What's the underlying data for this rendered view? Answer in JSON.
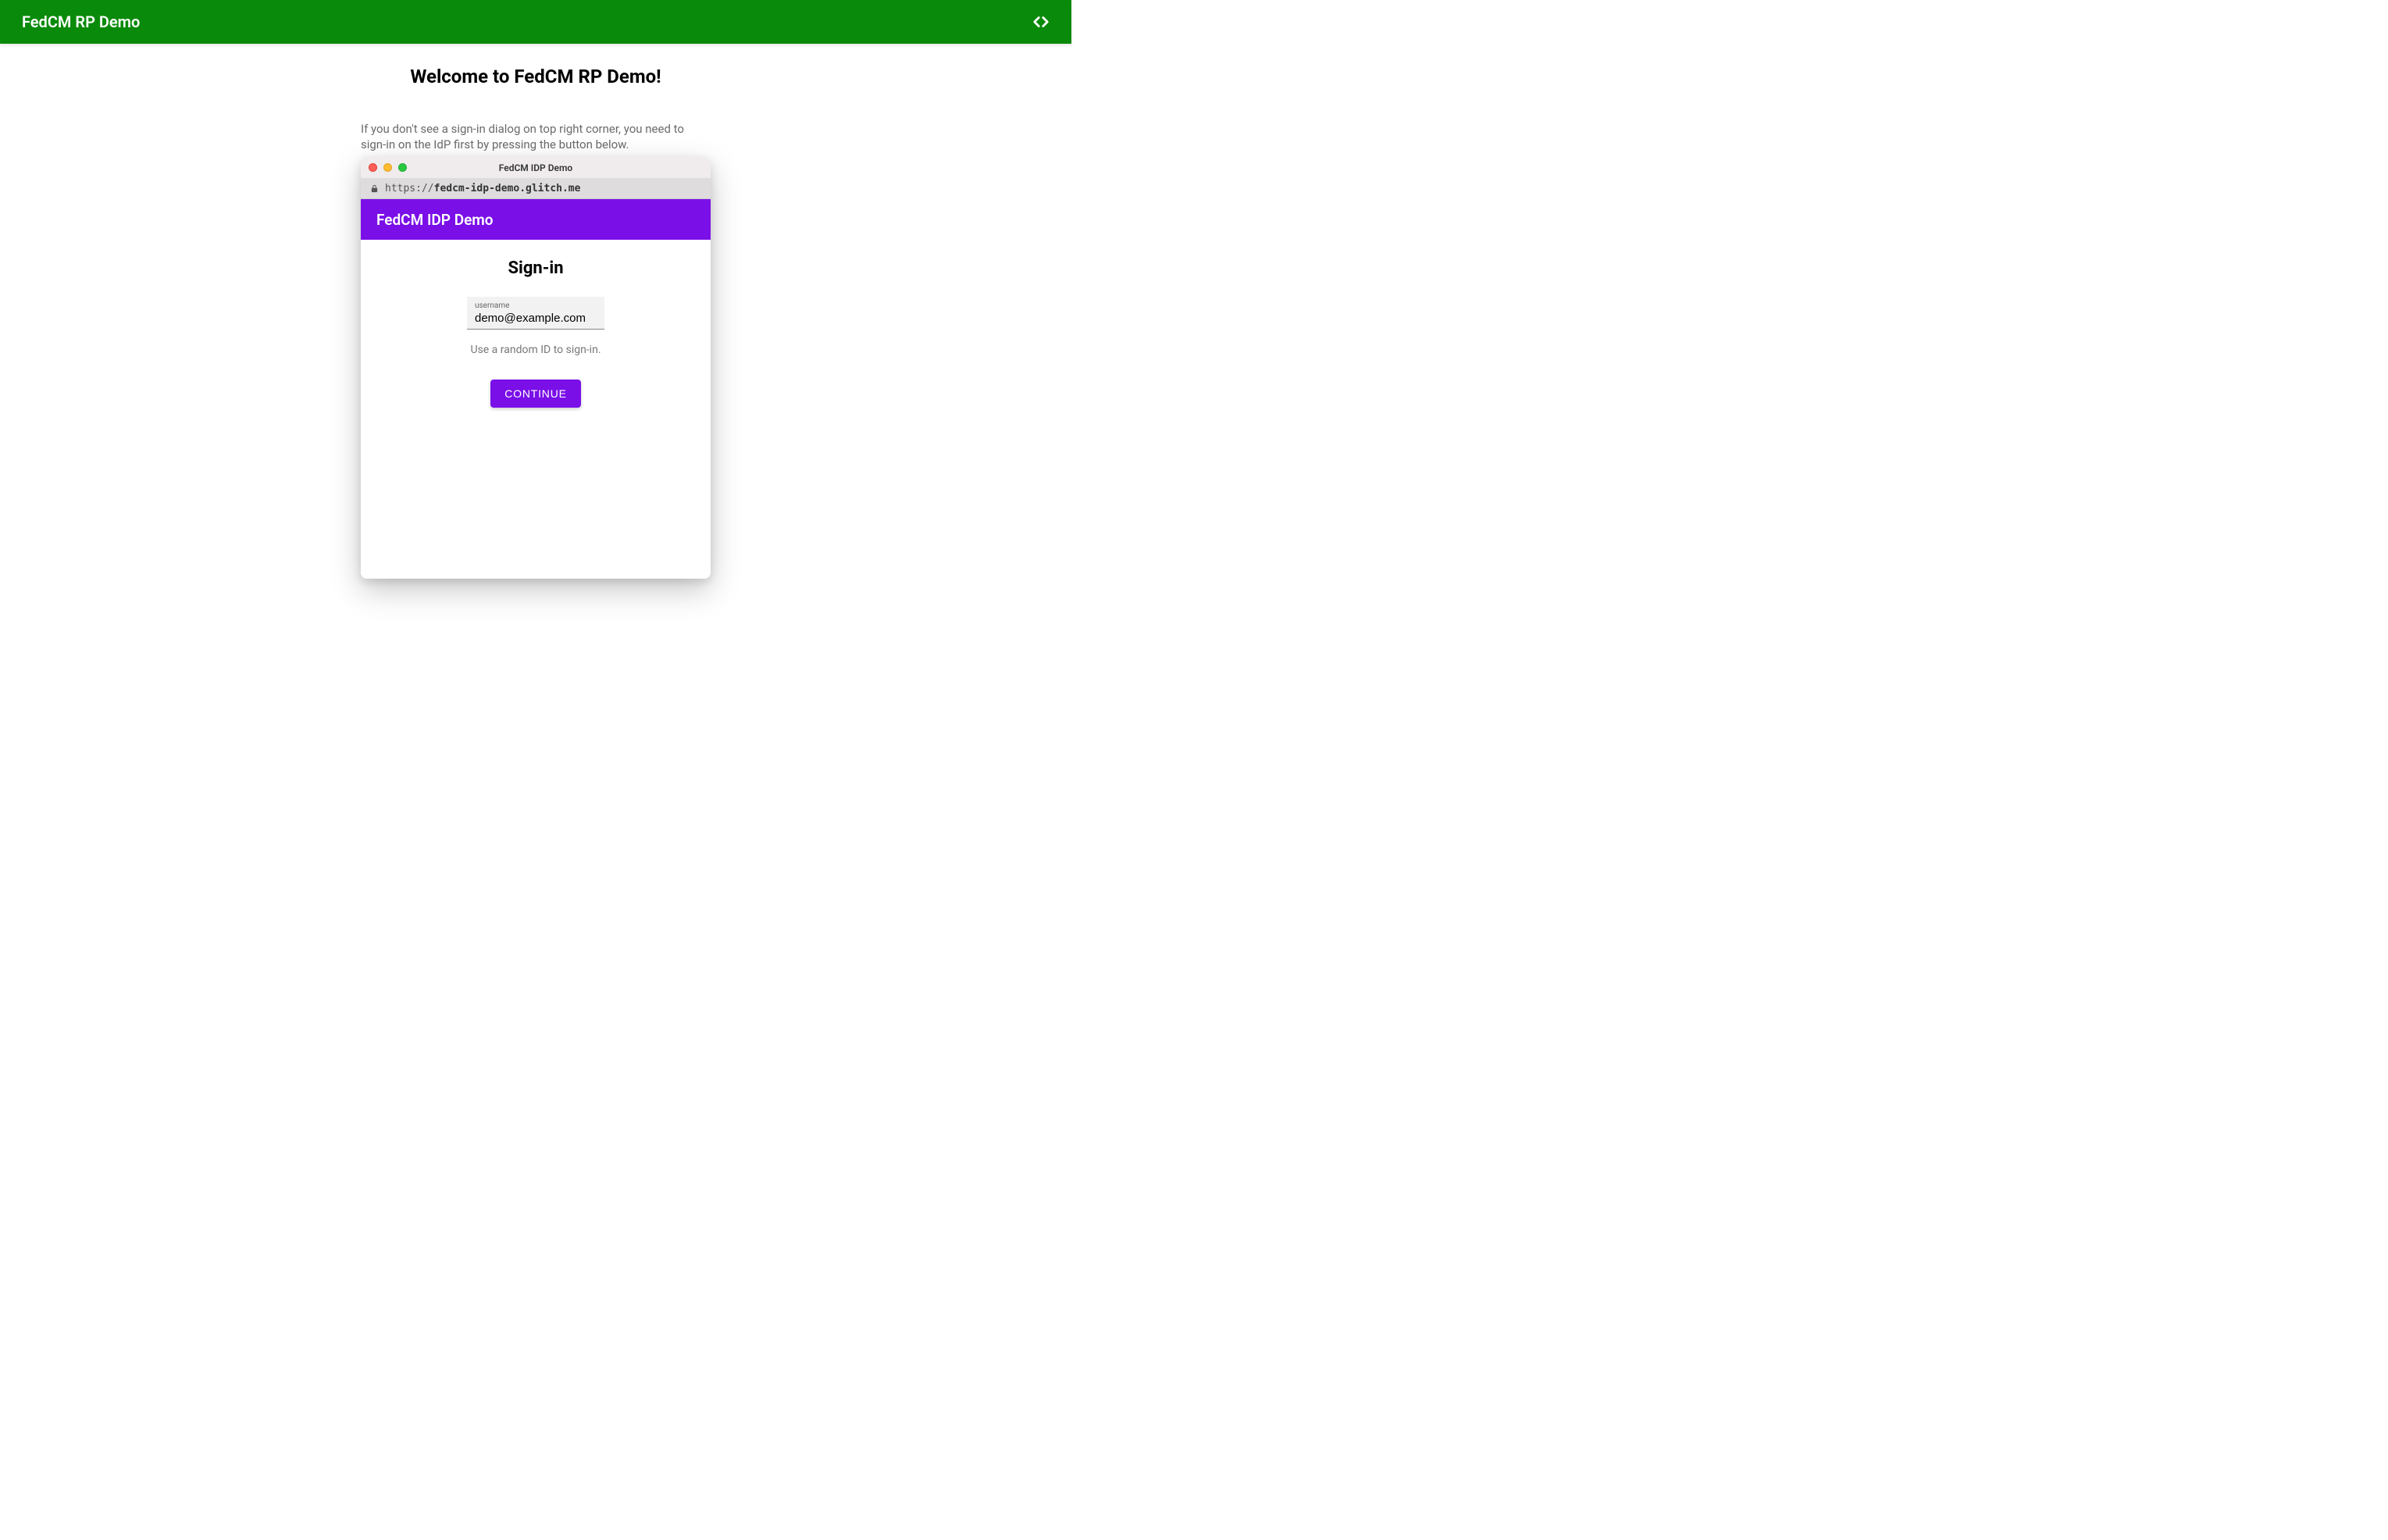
{
  "topbar": {
    "title": "FedCM RP Demo",
    "icon_name": "code-icon"
  },
  "page": {
    "heading": "Welcome to FedCM RP Demo!",
    "intro": "If you don't see a sign-in dialog on top right corner, you need to sign-in on the IdP first by pressing the button below."
  },
  "window": {
    "title": "FedCM IDP Demo",
    "url_protocol": "https://",
    "url_host": "fedcm-idp-demo.glitch.me"
  },
  "inner": {
    "header_title": "FedCM IDP Demo",
    "signin_heading": "Sign-in",
    "username_label": "username",
    "username_value": "demo@example.com",
    "hint": "Use a random ID to sign-in.",
    "continue_label": "Continue"
  },
  "colors": {
    "topbar_bg": "#0a8a0a",
    "accent": "#7a0fe8"
  }
}
